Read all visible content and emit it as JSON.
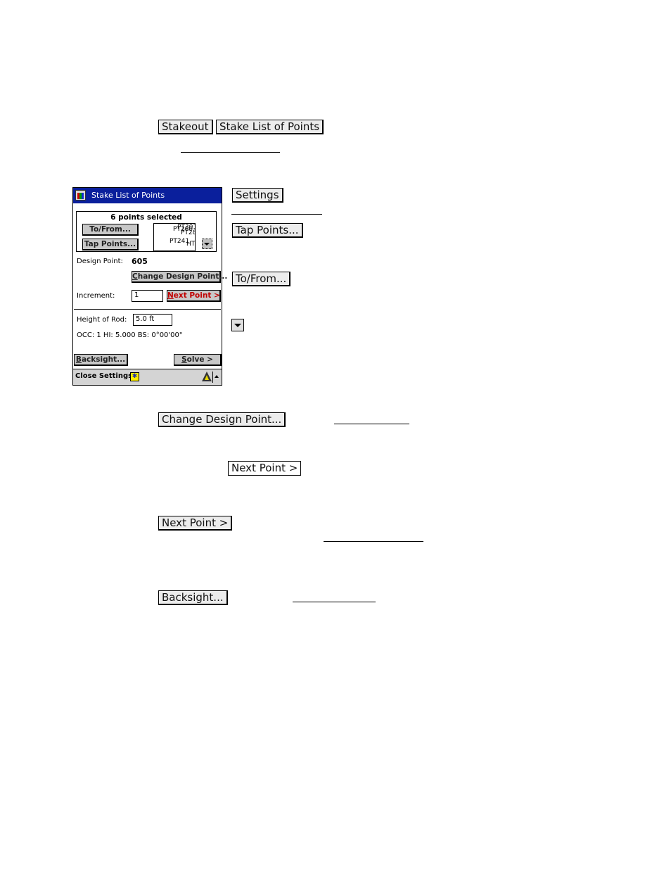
{
  "breadcrumb_buttons": [
    "Stakeout",
    "Stake List of Points"
  ],
  "side_buttons": {
    "settings": "Settings",
    "tap_points": "Tap Points...",
    "to_from": "To/From...",
    "dropdown_icon": "chevron-down-icon"
  },
  "body_buttons": {
    "change_design_point": "Change Design Point...",
    "next_point_1": "Next Point >",
    "next_point_2": "Next Point >",
    "backsight": "Backsight..."
  },
  "pda": {
    "title": "Stake List of Points",
    "points_selected": "6 points selected",
    "to_from_button": "To/From...",
    "tap_points_button": "Tap Points...",
    "map_labels": [
      "PT301",
      "PT260",
      "PT28",
      "PT241",
      "HT"
    ],
    "design_point_label": "Design Point:",
    "design_point_value": "605",
    "change_design_point_button_first": "C",
    "change_design_point_button_rest": "hange Design Point...",
    "increment_label": "Increment:",
    "increment_value": "1",
    "next_point_button_first": "N",
    "next_point_button_rest": "ext Point >",
    "height_of_rod_label": "Height of Rod:",
    "height_of_rod_value": "5.0 ft",
    "status_line": "OCC: 1  HI: 5.000  BS: 0°00'00\"",
    "backsight_button_first": "B",
    "backsight_button_rest": "acksight...",
    "solve_button_first": "S",
    "solve_button_rest": "olve >",
    "command_bar_label": "Close Settings",
    "accent_title_color": "#0a1f9c",
    "next_point_text_color": "#c00000"
  }
}
